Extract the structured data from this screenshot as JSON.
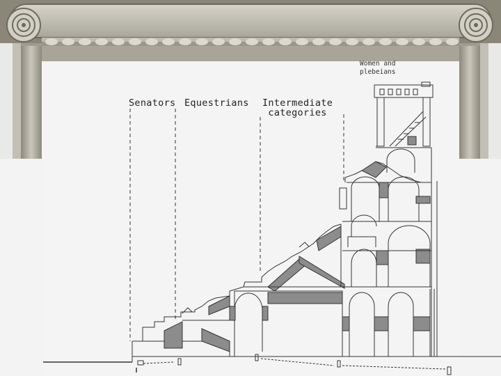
{
  "diagram": {
    "labels": {
      "senators": "Senators",
      "equestrians": "Equestrians",
      "intermediate": "Intermediate\ncategories",
      "women": "Women and\nplebeians"
    },
    "colors": {
      "frame_dark": "#7a7668",
      "frame_light": "#c8c6bb",
      "shading": "#8c8c8c",
      "line": "#333333"
    }
  }
}
